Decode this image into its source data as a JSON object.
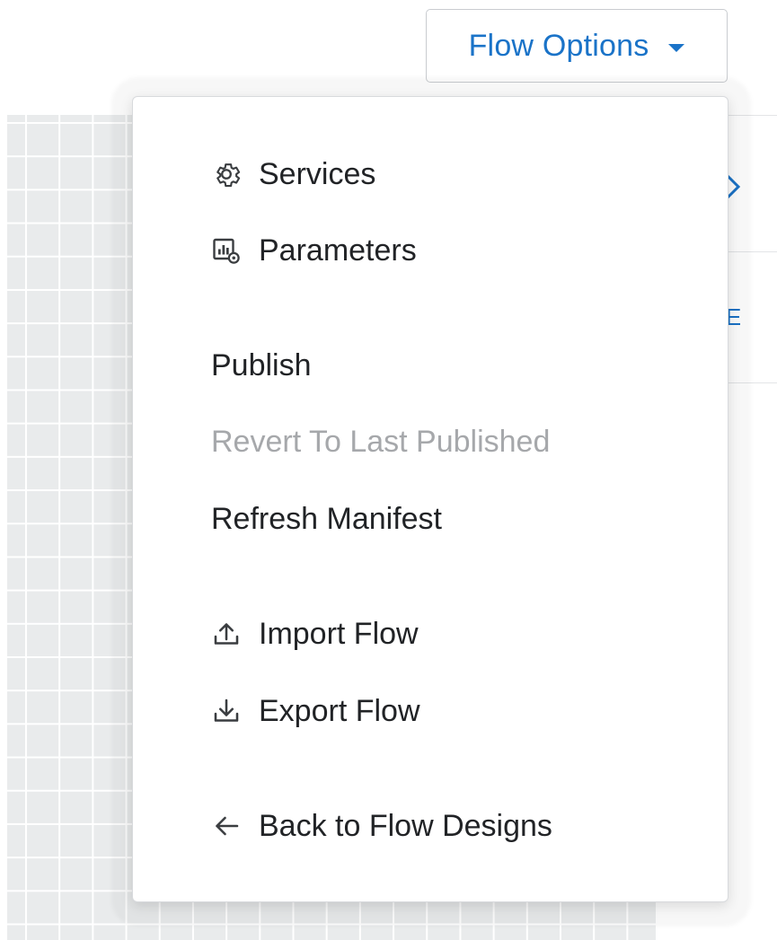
{
  "header": {
    "flow_options_label": "Flow Options",
    "flow_options_icon": "caret-down-icon"
  },
  "side_panel": {
    "partial_glyph_1": "close-icon",
    "partial_glyph_2": "E"
  },
  "menu": {
    "groups": [
      {
        "items": [
          {
            "label": "Services",
            "icon": "gear-icon",
            "enabled": true
          },
          {
            "label": "Parameters",
            "icon": "parameters-icon",
            "enabled": true
          }
        ]
      },
      {
        "items": [
          {
            "label": "Publish",
            "icon": null,
            "enabled": true
          },
          {
            "label": "Revert To Last Published",
            "icon": null,
            "enabled": false
          },
          {
            "label": "Refresh Manifest",
            "icon": null,
            "enabled": true
          }
        ]
      },
      {
        "items": [
          {
            "label": "Import Flow",
            "icon": "upload-icon",
            "enabled": true
          },
          {
            "label": "Export Flow",
            "icon": "download-icon",
            "enabled": true
          }
        ]
      },
      {
        "items": [
          {
            "label": "Back to Flow Designs",
            "icon": "arrow-left-icon",
            "enabled": true
          }
        ]
      }
    ]
  },
  "colors": {
    "accent": "#1a73c8",
    "text": "#212326",
    "disabled_text": "#a6a8ab",
    "canvas_background": "#e9ebec"
  }
}
